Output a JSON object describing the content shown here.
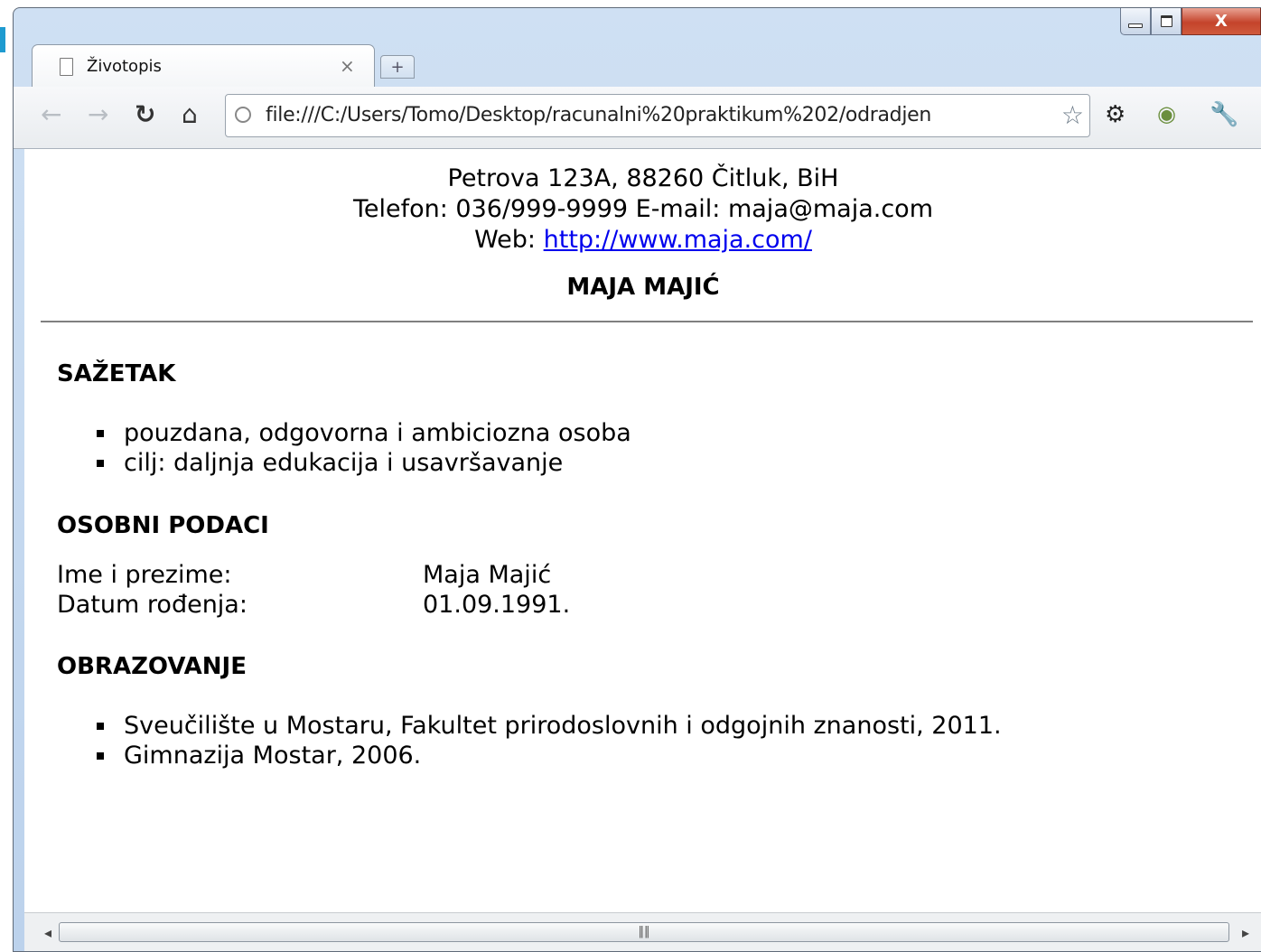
{
  "browser": {
    "tab_title": "Životopis",
    "tab_close": "×",
    "new_tab": "+",
    "url": "file:///C:/Users/Tomo/Desktop/racunalni%20praktikum%202/odradjen",
    "window_close": "X"
  },
  "page": {
    "address_line": "Petrova 123A, 88260 Čitluk, BiH",
    "contact_line": "Telefon: 036/999-9999 E-mail: maja@maja.com",
    "web_prefix": "Web:",
    "web_link": "http://www.maja.com/",
    "name": "MAJA MAJIĆ",
    "summary": {
      "heading": "SAŽETAK",
      "items": [
        "pouzdana, odgovorna i ambiciozna osoba",
        "cilj: daljnja edukacija i usavršavanje"
      ]
    },
    "personal": {
      "heading": "OSOBNI PODACI",
      "rows": [
        {
          "label": "Ime i prezime:",
          "value": "Maja Majić"
        },
        {
          "label": "Datum rođenja:",
          "value": "01.09.1991."
        }
      ]
    },
    "education": {
      "heading": "OBRAZOVANJE",
      "items": [
        "Sveučilište u Mostaru, Fakultet prirodoslovnih i odgojnih znanosti, 2011.",
        "Gimnazija Mostar, 2006."
      ]
    }
  }
}
